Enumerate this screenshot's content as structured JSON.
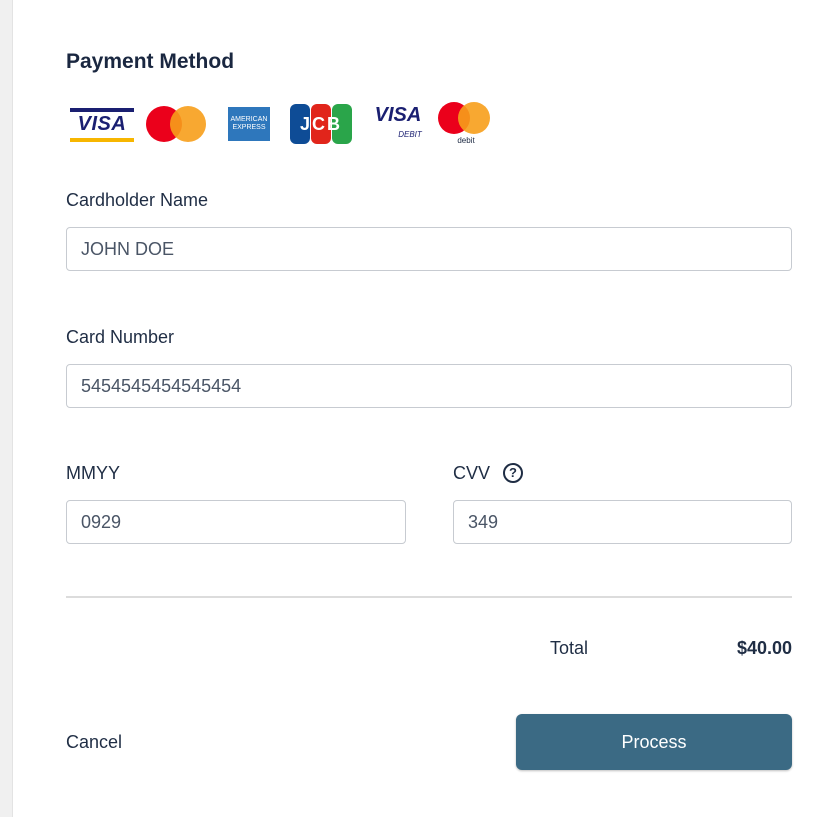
{
  "form": {
    "title": "Payment Method",
    "card_logos": [
      {
        "name": "visa-logo",
        "text": "VISA"
      },
      {
        "name": "mastercard-logo",
        "text": ""
      },
      {
        "name": "amex-logo",
        "text": "AMERICAN EXPRESS"
      },
      {
        "name": "jcb-logo",
        "text": "JCB"
      },
      {
        "name": "visa-debit-logo",
        "text": "VISA",
        "sub": "DEBIT"
      },
      {
        "name": "mastercard-debit-logo",
        "text": "",
        "sub": "debit"
      }
    ],
    "cardholder": {
      "label": "Cardholder Name",
      "value": "JOHN DOE"
    },
    "card_number": {
      "label": "Card Number",
      "value": "5454545454545454"
    },
    "expiry": {
      "label": "MMYY",
      "value": "0929"
    },
    "cvv": {
      "label": "CVV",
      "value": "349",
      "help_icon": "?"
    },
    "total": {
      "label": "Total",
      "value": "$40.00"
    },
    "actions": {
      "cancel": "Cancel",
      "process": "Process"
    }
  },
  "colors": {
    "primary_button": "#3b6a84",
    "text": "#1f2d44",
    "border": "#c7cbd1"
  }
}
